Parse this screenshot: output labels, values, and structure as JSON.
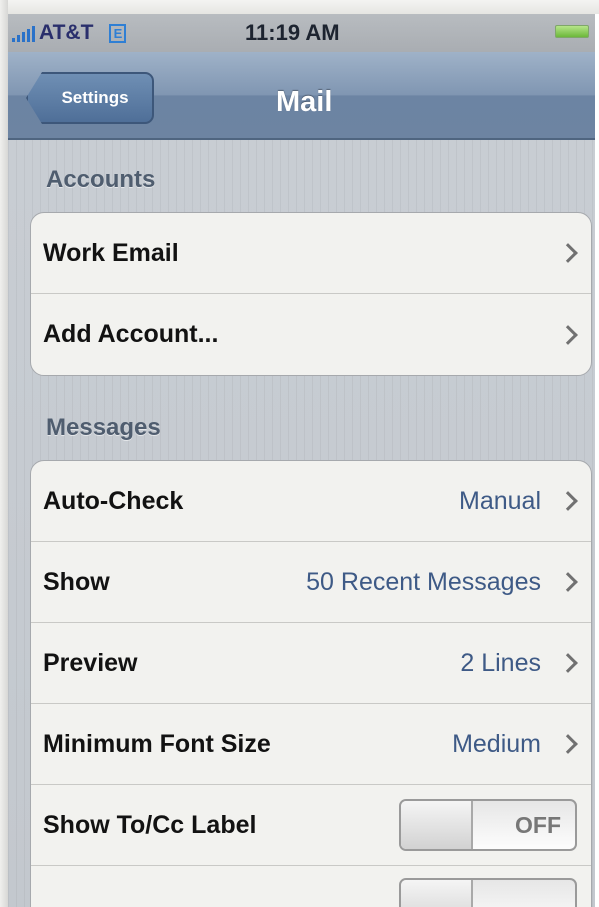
{
  "status_bar": {
    "carrier": "AT&T",
    "network_badge": "E",
    "time": "11:19 AM",
    "signal_icon": "signal-bars-icon",
    "battery_icon": "battery-full-icon",
    "signal_color": "#2a72c9",
    "battery_color": "#6cb83a"
  },
  "nav": {
    "back_label": "Settings",
    "title": "Mail"
  },
  "sections": {
    "accounts": {
      "header": "Accounts",
      "rows": [
        {
          "label": "Work Email",
          "icon": "chevron-right-icon"
        },
        {
          "label": "Add Account...",
          "icon": "chevron-right-icon"
        }
      ]
    },
    "messages": {
      "header": "Messages",
      "rows": [
        {
          "label": "Auto-Check",
          "value": "Manual",
          "icon": "chevron-right-icon"
        },
        {
          "label": "Show",
          "value": "50 Recent Messages",
          "icon": "chevron-right-icon"
        },
        {
          "label": "Preview",
          "value": "2 Lines",
          "icon": "chevron-right-icon"
        },
        {
          "label": "Minimum Font Size",
          "value": "Medium",
          "icon": "chevron-right-icon"
        },
        {
          "label": "Show To/Cc Label",
          "toggle": "OFF"
        }
      ]
    }
  },
  "colors": {
    "nav_bar": "#8096b2",
    "value_text": "#3e5a86",
    "section_header": "#4f5d6f"
  }
}
